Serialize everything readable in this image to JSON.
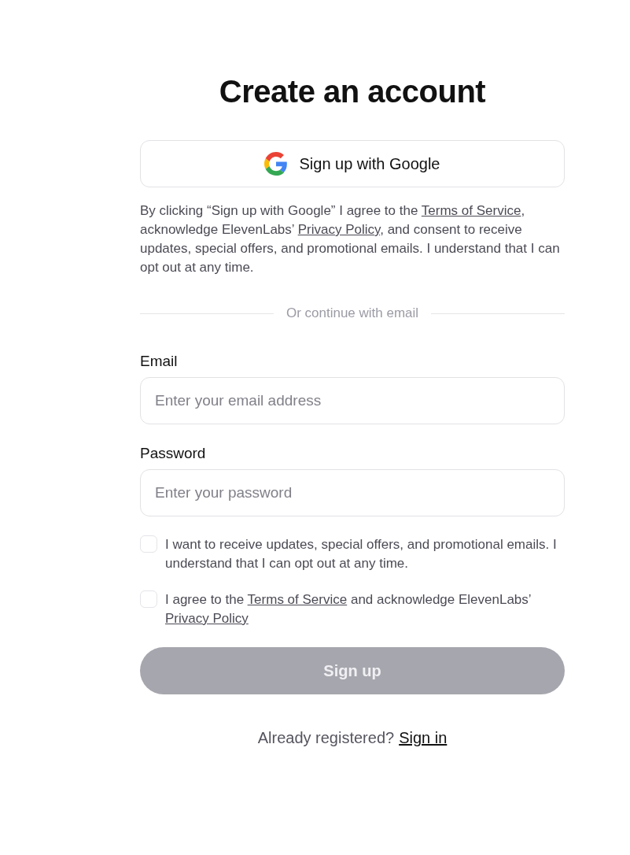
{
  "title": "Create an account",
  "google_button": {
    "label": "Sign up with Google"
  },
  "google_notice": [
    {
      "kind": "text",
      "text": "By clicking “Sign up with Google” I agree to the "
    },
    {
      "kind": "link",
      "text": "Terms of Service"
    },
    {
      "kind": "text",
      "text": ", acknowledge ElevenLabs’ "
    },
    {
      "kind": "link",
      "text": "Privacy Policy"
    },
    {
      "kind": "text",
      "text": ", and consent to receive updates, special offers, and promotional emails. I understand that I can opt out at any time."
    }
  ],
  "divider_label": "Or continue with email",
  "fields": [
    {
      "label": "Email",
      "placeholder": "Enter your email address"
    },
    {
      "label": "Password",
      "placeholder": "Enter your password"
    }
  ],
  "checkboxes": [
    {
      "checked": false,
      "label": [
        {
          "kind": "text",
          "text": "I want to receive updates, special offers, and promotional emails. I understand that I can opt out at any time."
        }
      ]
    },
    {
      "checked": false,
      "label": [
        {
          "kind": "text",
          "text": "I agree to the "
        },
        {
          "kind": "link",
          "text": "Terms of Service"
        },
        {
          "kind": "text",
          "text": " and acknowledge ElevenLabs’ "
        },
        {
          "kind": "link",
          "text": "Privacy Policy"
        }
      ]
    }
  ],
  "submit_button": {
    "label": "Sign up",
    "disabled": true
  },
  "footer": {
    "text": "Already registered?",
    "link": "Sign in"
  }
}
